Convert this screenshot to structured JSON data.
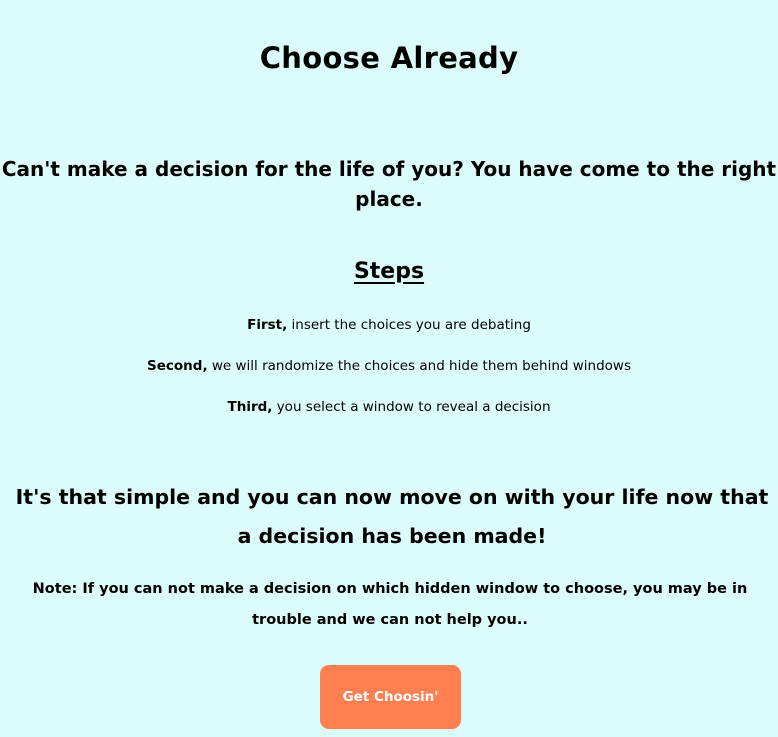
{
  "header": {
    "title": "Choose Already"
  },
  "intro": {
    "tagline": "Can't make a decision for the life of you? You have come to the right place."
  },
  "steps": {
    "heading": "Steps",
    "items": [
      {
        "ordinal": "First,",
        "text": " insert the choices you are debating"
      },
      {
        "ordinal": "Second,",
        "text": " we will randomize the choices and hide them behind windows"
      },
      {
        "ordinal": "Third,",
        "text": " you select a window to reveal a decision"
      }
    ]
  },
  "closing": {
    "text": "It's that simple and you can now move on with your life now that a decision has been made!"
  },
  "note": {
    "text": "Note: If you can not make a decision on which hidden window to choose, you may be in trouble and we can not help you.."
  },
  "cta": {
    "label": "Get Choosin'"
  },
  "colors": {
    "background": "#dcfcfb",
    "button": "#ff7f50",
    "button_text": "#ffffff",
    "text": "#000000"
  }
}
